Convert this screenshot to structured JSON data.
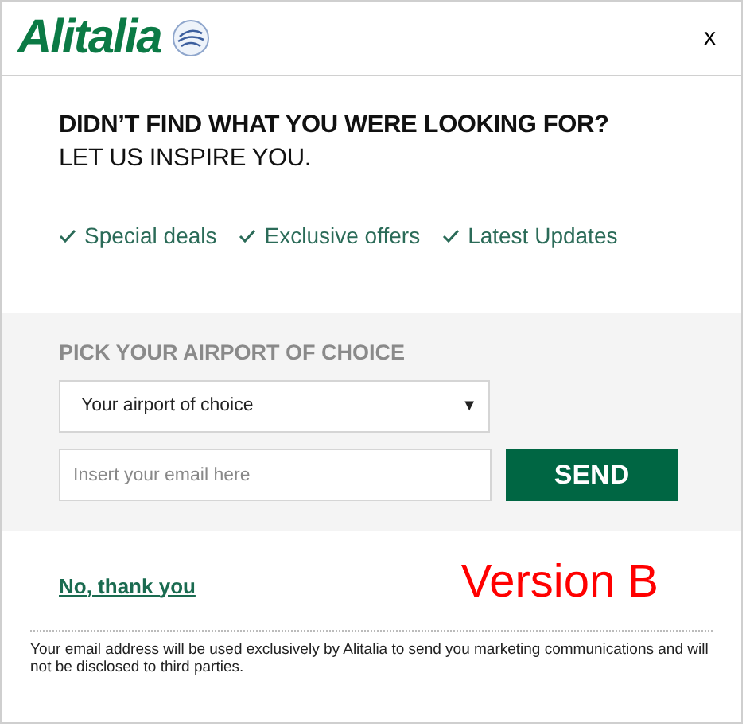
{
  "header": {
    "logo": "Alitalia",
    "close": "x"
  },
  "headline": {
    "line_1": "DIDN’T FIND WHAT YOU WERE LOOKING FOR?",
    "line_2": "LET US INSPIRE YOU."
  },
  "benefits": [
    "Special deals",
    "Exclusive offers",
    "Latest Updates"
  ],
  "form": {
    "title": "PICK YOUR AIRPORT OF CHOICE",
    "airport_select": {
      "value": "Your airport of choice",
      "arrow": "▼"
    },
    "email": {
      "placeholder": "Insert your email here"
    },
    "send_button": "SEND"
  },
  "decline_link": "No, thank you",
  "annotation": "Version B",
  "disclaimer": "Your email address will be used exclusively by Alitalia to send you marketing communications and will not be disclosed to third parties."
}
